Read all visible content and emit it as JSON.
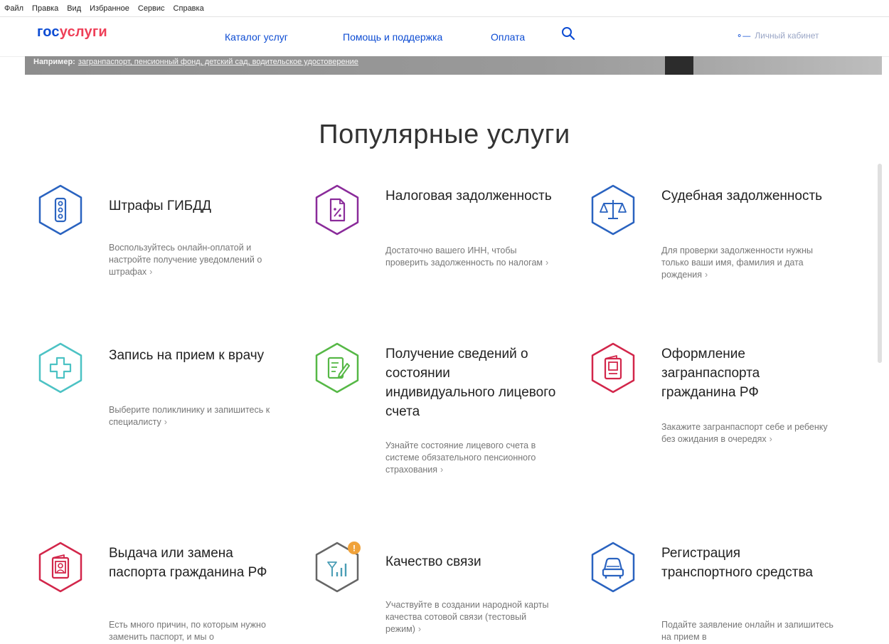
{
  "menubar": [
    "Файл",
    "Правка",
    "Вид",
    "Избранное",
    "Сервис",
    "Справка"
  ],
  "header": {
    "logo_gos": "гос",
    "logo_uslugi": "услуги",
    "nav": [
      "Каталог услуг",
      "Помощь и поддержка",
      "Оплата"
    ],
    "cabinet": "Личный кабинет"
  },
  "banner": {
    "example_label": "Например:",
    "example_text": "загранпаспорт, пенсионный фонд, детский сад, водительское удостоверение"
  },
  "section_title": "Популярные услуги",
  "services": [
    {
      "title": "Штрафы ГИБДД",
      "desc": "Воспользуйтесь онлайн-оплатой и настройте получение уведомлений о штрафах",
      "icon": "traffic-light-icon",
      "color": "#2a63c0"
    },
    {
      "title": "Налоговая задолженность",
      "desc": "Достаточно вашего ИНН, чтобы проверить задолженность по налогам",
      "icon": "tax-document-icon",
      "color": "#8a2b9a"
    },
    {
      "title": "Судебная задолженность",
      "desc": "Для проверки задолженности нужны только ваши имя, фамилия и дата рождения",
      "icon": "scales-icon",
      "color": "#2a63c0"
    },
    {
      "title": "Запись на прием к врачу",
      "desc": "Выберите поликлинику и запишитесь к специалисту",
      "icon": "medical-cross-icon",
      "color": "#4cc2c4"
    },
    {
      "title": "Получение сведений о состоянии индивидуального лицевого счета",
      "desc": "Узнайте состояние лицевого счета в системе обязательного пенсионного страхования",
      "icon": "edit-document-icon",
      "color": "#56b846"
    },
    {
      "title": "Оформление загранпаспорта гражданина РФ",
      "desc": "Закажите загранпаспорт себе и ребенку без ожидания в очередях",
      "icon": "passport-icon",
      "color": "#d2264a"
    },
    {
      "title": "Выдача или замена паспорта гражданина РФ",
      "desc": "Есть много причин, по которым нужно заменить паспорт, и мы о",
      "icon": "passport-person-icon",
      "color": "#d2264a"
    },
    {
      "title": "Качество связи",
      "desc": "Участвуйте в создании народной карты качества сотовой связи (тестовый режим)",
      "icon": "cell-signal-icon",
      "color": "#666666",
      "badge": "!"
    },
    {
      "title": "Регистрация транспортного средства",
      "desc": "Подайте заявление онлайн и запишитесь на прием в",
      "icon": "car-icon",
      "color": "#2a63c0"
    }
  ]
}
